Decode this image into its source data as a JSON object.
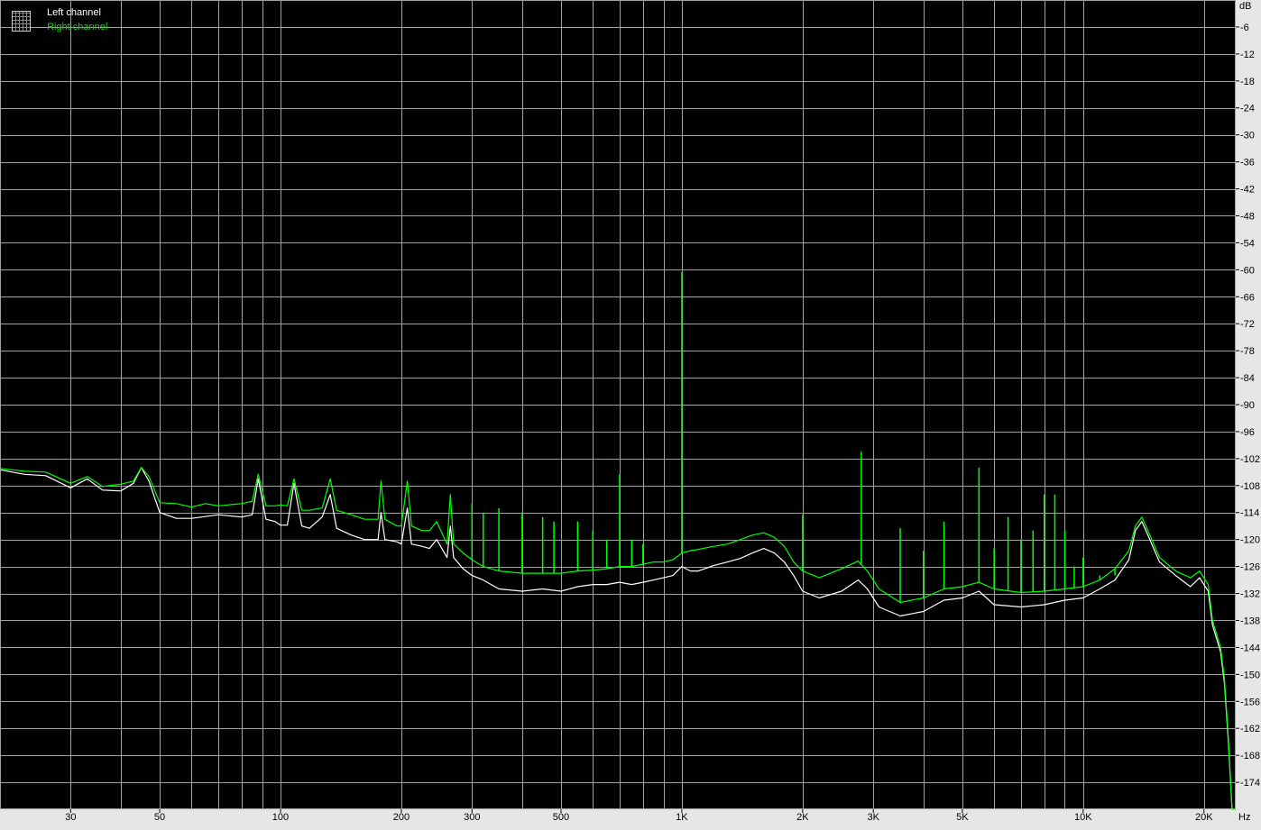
{
  "chart_data": {
    "type": "line",
    "xscale": "log",
    "xlim": [
      20,
      24000
    ],
    "ylim": [
      -180,
      0
    ],
    "grid": true,
    "background": "#000000",
    "grid_color": "#a0a0a0",
    "x_unit": "Hz",
    "y_unit": "dB",
    "x_tick_labels": [
      {
        "value": 30,
        "label": "30"
      },
      {
        "value": 50,
        "label": "50"
      },
      {
        "value": 100,
        "label": "100"
      },
      {
        "value": 200,
        "label": "200"
      },
      {
        "value": 300,
        "label": "300"
      },
      {
        "value": 500,
        "label": "500"
      },
      {
        "value": 1000,
        "label": "1K"
      },
      {
        "value": 2000,
        "label": "2K"
      },
      {
        "value": 3000,
        "label": "3K"
      },
      {
        "value": 5000,
        "label": "5K"
      },
      {
        "value": 10000,
        "label": "10K"
      },
      {
        "value": 20000,
        "label": "20K"
      }
    ],
    "y_tick_labels": [
      "-6",
      "-12",
      "-18",
      "-24",
      "-30",
      "-36",
      "-42",
      "-48",
      "-54",
      "-60",
      "-66",
      "-72",
      "-78",
      "-84",
      "-90",
      "-96",
      "-102",
      "-108",
      "-114",
      "-120",
      "-126",
      "-132",
      "-138",
      "-144",
      "-150",
      "-156",
      "-162",
      "-168",
      "-174"
    ],
    "legend_position": "top-left",
    "series": [
      {
        "name": "Left channel",
        "color": "#ffffff",
        "points": [
          [
            20,
            -104.5
          ],
          [
            23,
            -105.5
          ],
          [
            26,
            -105.8
          ],
          [
            30,
            -108.5
          ],
          [
            33,
            -106.5
          ],
          [
            36,
            -109
          ],
          [
            40,
            -109.2
          ],
          [
            43,
            -107.5
          ],
          [
            45,
            -104
          ],
          [
            47,
            -107
          ],
          [
            50,
            -114
          ],
          [
            55,
            -115.3
          ],
          [
            60,
            -115.3
          ],
          [
            70,
            -114.5
          ],
          [
            80,
            -115
          ],
          [
            85,
            -114.5
          ],
          [
            88,
            -106.5
          ],
          [
            92,
            -115.5
          ],
          [
            97,
            -116
          ],
          [
            100,
            -116.8
          ],
          [
            104,
            -116.8
          ],
          [
            108,
            -107.5
          ],
          [
            113,
            -117
          ],
          [
            118,
            -117.5
          ],
          [
            127,
            -115
          ],
          [
            133,
            -110
          ],
          [
            138,
            -117.5
          ],
          [
            150,
            -119
          ],
          [
            162,
            -120
          ],
          [
            175,
            -120
          ],
          [
            178,
            -114
          ],
          [
            182,
            -120
          ],
          [
            195,
            -120.5
          ],
          [
            200,
            -121
          ],
          [
            207,
            -113
          ],
          [
            212,
            -121
          ],
          [
            225,
            -121.5
          ],
          [
            235,
            -122
          ],
          [
            245,
            -120
          ],
          [
            260,
            -124
          ],
          [
            265,
            -117
          ],
          [
            270,
            -124
          ],
          [
            285,
            -126.5
          ],
          [
            300,
            -128
          ],
          [
            320,
            -129
          ],
          [
            350,
            -131
          ],
          [
            400,
            -131.5
          ],
          [
            450,
            -131
          ],
          [
            500,
            -131.5
          ],
          [
            550,
            -130.5
          ],
          [
            600,
            -130
          ],
          [
            650,
            -130
          ],
          [
            700,
            -129.5
          ],
          [
            750,
            -130
          ],
          [
            800,
            -129.5
          ],
          [
            850,
            -129
          ],
          [
            900,
            -128.5
          ],
          [
            950,
            -128
          ],
          [
            1000,
            -126
          ],
          [
            1050,
            -127
          ],
          [
            1100,
            -127
          ],
          [
            1200,
            -125.8
          ],
          [
            1300,
            -125
          ],
          [
            1400,
            -124.2
          ],
          [
            1500,
            -123
          ],
          [
            1600,
            -122
          ],
          [
            1700,
            -123
          ],
          [
            1800,
            -125
          ],
          [
            1900,
            -128
          ],
          [
            2000,
            -131.5
          ],
          [
            2200,
            -133
          ],
          [
            2500,
            -131.5
          ],
          [
            2750,
            -129
          ],
          [
            2900,
            -131
          ],
          [
            3100,
            -135
          ],
          [
            3500,
            -137
          ],
          [
            4000,
            -136
          ],
          [
            4500,
            -133.5
          ],
          [
            5000,
            -133
          ],
          [
            5500,
            -131.5
          ],
          [
            6000,
            -134.5
          ],
          [
            7000,
            -135
          ],
          [
            8000,
            -134.5
          ],
          [
            9000,
            -133.5
          ],
          [
            10000,
            -133
          ],
          [
            11000,
            -131
          ],
          [
            12000,
            -129
          ],
          [
            13000,
            -124.5
          ],
          [
            13500,
            -118
          ],
          [
            14000,
            -116
          ],
          [
            14500,
            -119
          ],
          [
            15500,
            -125
          ],
          [
            17000,
            -128
          ],
          [
            18500,
            -130.5
          ],
          [
            19500,
            -128.5
          ],
          [
            20500,
            -131.5
          ],
          [
            21000,
            -139
          ],
          [
            22000,
            -145
          ],
          [
            22500,
            -152
          ],
          [
            23000,
            -165
          ],
          [
            23500,
            -180
          ],
          [
            24000,
            -180
          ]
        ]
      },
      {
        "name": "Right channel",
        "color": "#00ff00",
        "points": [
          [
            20,
            -104.2
          ],
          [
            23,
            -104.8
          ],
          [
            26,
            -105
          ],
          [
            30,
            -107.5
          ],
          [
            33,
            -106
          ],
          [
            36,
            -108.2
          ],
          [
            40,
            -107.7
          ],
          [
            43,
            -107
          ],
          [
            45,
            -104
          ],
          [
            47,
            -106
          ],
          [
            50,
            -111.8
          ],
          [
            55,
            -112
          ],
          [
            60,
            -112.8
          ],
          [
            65,
            -112
          ],
          [
            70,
            -112.5
          ],
          [
            80,
            -112
          ],
          [
            85,
            -111.5
          ],
          [
            88,
            -105.5
          ],
          [
            92,
            -112.5
          ],
          [
            97,
            -112.5
          ],
          [
            100,
            -112.3
          ],
          [
            104,
            -112.5
          ],
          [
            108,
            -106.5
          ],
          [
            113,
            -113.5
          ],
          [
            118,
            -113.5
          ],
          [
            127,
            -113
          ],
          [
            133,
            -106.5
          ],
          [
            138,
            -113.5
          ],
          [
            150,
            -114.5
          ],
          [
            162,
            -115.5
          ],
          [
            175,
            -115.5
          ],
          [
            178,
            -107
          ],
          [
            182,
            -115.5
          ],
          [
            195,
            -117
          ],
          [
            200,
            -117
          ],
          [
            207,
            -107
          ],
          [
            212,
            -117
          ],
          [
            225,
            -118
          ],
          [
            235,
            -118
          ],
          [
            245,
            -116
          ],
          [
            260,
            -121
          ],
          [
            265,
            -110
          ],
          [
            270,
            -121
          ],
          [
            285,
            -123
          ],
          [
            300,
            -124.5
          ],
          [
            320,
            -126
          ],
          [
            350,
            -127
          ],
          [
            400,
            -127.5
          ],
          [
            450,
            -127.5
          ],
          [
            500,
            -127.5
          ],
          [
            550,
            -127
          ],
          [
            600,
            -126.8
          ],
          [
            650,
            -126.5
          ],
          [
            700,
            -126
          ],
          [
            750,
            -126
          ],
          [
            800,
            -125.5
          ],
          [
            850,
            -125
          ],
          [
            900,
            -125
          ],
          [
            950,
            -124.5
          ],
          [
            1000,
            -123
          ],
          [
            1050,
            -122.5
          ],
          [
            1100,
            -122.2
          ],
          [
            1200,
            -121.5
          ],
          [
            1300,
            -121
          ],
          [
            1400,
            -120
          ],
          [
            1500,
            -119
          ],
          [
            1600,
            -118.5
          ],
          [
            1700,
            -119.5
          ],
          [
            1800,
            -121.5
          ],
          [
            1900,
            -125
          ],
          [
            2000,
            -127
          ],
          [
            2200,
            -128.5
          ],
          [
            2500,
            -126.5
          ],
          [
            2750,
            -124.8
          ],
          [
            2900,
            -127
          ],
          [
            3100,
            -131
          ],
          [
            3500,
            -134
          ],
          [
            4000,
            -133
          ],
          [
            4500,
            -131
          ],
          [
            5000,
            -130.5
          ],
          [
            5500,
            -129.5
          ],
          [
            6000,
            -131
          ],
          [
            7000,
            -131.8
          ],
          [
            8000,
            -131.5
          ],
          [
            9000,
            -131
          ],
          [
            10000,
            -130.5
          ],
          [
            11000,
            -129
          ],
          [
            12000,
            -126.5
          ],
          [
            13000,
            -122.5
          ],
          [
            13500,
            -117
          ],
          [
            14000,
            -115
          ],
          [
            14500,
            -118
          ],
          [
            15500,
            -124
          ],
          [
            17000,
            -127
          ],
          [
            18500,
            -128.5
          ],
          [
            19500,
            -127
          ],
          [
            20500,
            -130
          ],
          [
            21000,
            -138
          ],
          [
            22000,
            -144
          ],
          [
            22500,
            -151
          ],
          [
            23000,
            -164
          ],
          [
            23500,
            -180
          ],
          [
            24000,
            -180
          ]
        ]
      }
    ],
    "right_channel_spikes": [
      [
        1000,
        -60.5
      ],
      [
        700,
        -105.5
      ],
      [
        2000,
        -114.5
      ],
      [
        2800,
        -100.5
      ],
      [
        3500,
        -117.5
      ],
      [
        4000,
        -122.5
      ],
      [
        4500,
        -116
      ],
      [
        5500,
        -104
      ],
      [
        6000,
        -122
      ],
      [
        6500,
        -115
      ],
      [
        7000,
        -120
      ],
      [
        7500,
        -118
      ],
      [
        8000,
        -110
      ],
      [
        8500,
        -110
      ],
      [
        9000,
        -118
      ],
      [
        9500,
        -126
      ],
      [
        10000,
        -124
      ],
      [
        11000,
        -128
      ],
      [
        12000,
        -128
      ],
      [
        300,
        -112
      ],
      [
        320,
        -114
      ],
      [
        350,
        -113
      ],
      [
        400,
        -114
      ],
      [
        450,
        -115
      ],
      [
        480,
        -116
      ],
      [
        550,
        -116
      ],
      [
        600,
        -118
      ],
      [
        650,
        -120
      ],
      [
        750,
        -120
      ],
      [
        800,
        -121
      ]
    ]
  },
  "legend": {
    "left_label": "Left channel",
    "right_label": "Right channel"
  },
  "axis_units": {
    "y": "dB",
    "x": "Hz"
  }
}
